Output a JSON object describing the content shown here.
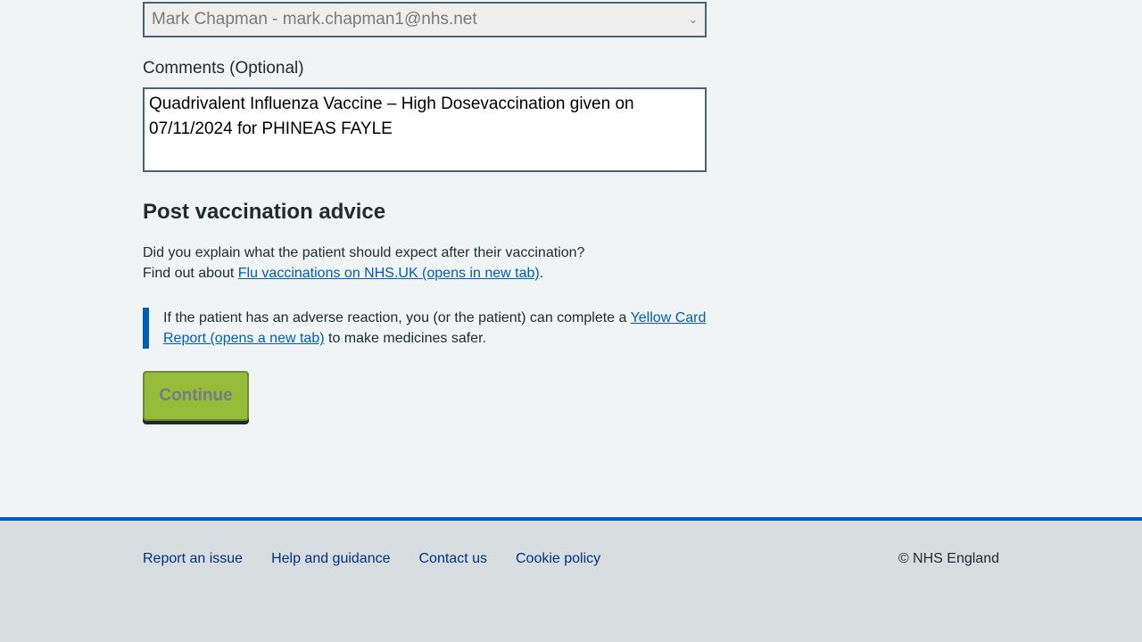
{
  "form": {
    "selected_user": "Mark Chapman - mark.chapman1@nhs.net",
    "comments_label": "Comments (Optional)",
    "comments_value": "Quadrivalent Influenza Vaccine – High Dosevaccination given on 07/11/2024 for PHINEAS FAYLE"
  },
  "advice": {
    "heading": "Post vaccination advice",
    "question": "Did you explain what the patient should expect after their vaccination?",
    "find_out_prefix": "Find out about ",
    "flu_link": "Flu vaccinations on NHS.UK (opens in new tab)",
    "find_out_suffix": ".",
    "inset_prefix": "If the patient has an adverse reaction, you (or the patient) can complete a ",
    "yellow_card_link": "Yellow Card Report (opens a new tab)",
    "inset_suffix": " to make medicines safer."
  },
  "continue_label": "Continue",
  "footer": {
    "links": [
      "Report an issue",
      "Help and guidance",
      "Contact us",
      "Cookie policy"
    ],
    "copyright": "© NHS England"
  }
}
